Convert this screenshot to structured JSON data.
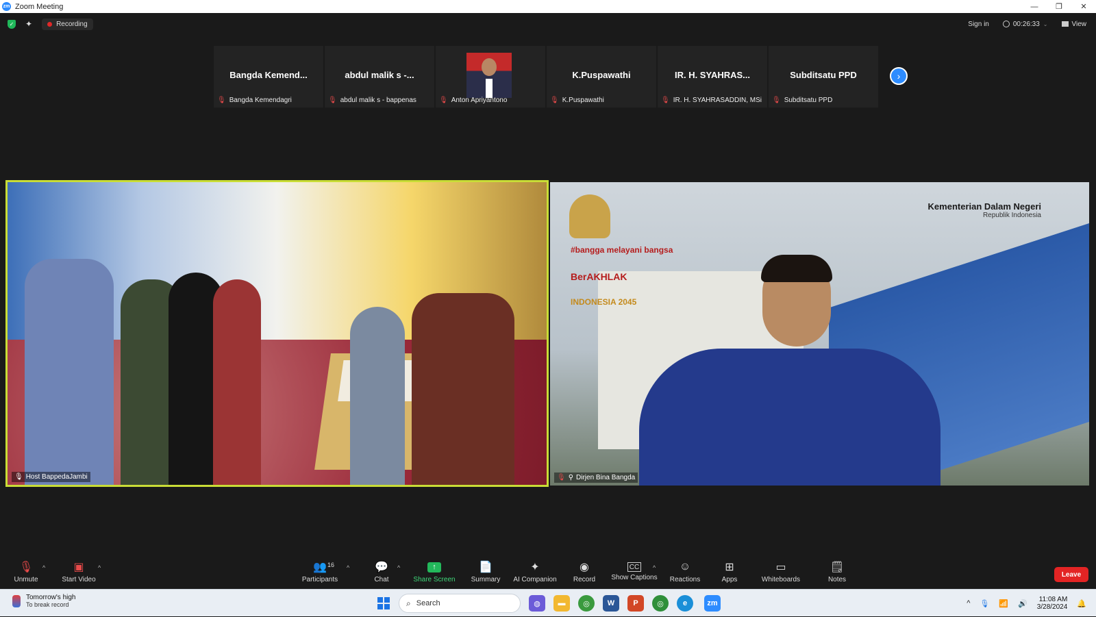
{
  "window": {
    "title": "Zoom Meeting",
    "controls": [
      "—",
      "❐",
      "✕"
    ]
  },
  "topbar": {
    "recording_label": "Recording",
    "sign_in": "Sign in",
    "timer": "00:26:33",
    "view_label": "View"
  },
  "gallery": {
    "tiles": [
      {
        "display": "Bangda Kemend...",
        "label": "Bangda Kemendagri"
      },
      {
        "display": "abdul malik s -...",
        "label": "abdul malik s - bappenas"
      },
      {
        "display": "",
        "label": "Anton Apriyantono"
      },
      {
        "display": "K.Puspawathi",
        "label": "K.Puspawathi"
      },
      {
        "display": "IR. H. SYAHRAS...",
        "label": "IR. H. SYAHRASADDIN, MSi"
      },
      {
        "display": "Subditsatu PPD",
        "label": "Subditsatu PPD"
      }
    ]
  },
  "videos": {
    "left": {
      "label": "Host BappedaJambi"
    },
    "right": {
      "label": "Dirjen Bina Bangda",
      "backdrop_title": "Kementerian Dalam Negeri",
      "backdrop_sub": "Republik Indonesia",
      "logo_1": "#bangga melayani bangsa",
      "logo_2": "BerAKHLAK",
      "logo_3": "INDONESIA 2045"
    }
  },
  "toolbar": {
    "unmute": "Unmute",
    "start_video": "Start Video",
    "participants": "Participants",
    "participants_count": "16",
    "chat": "Chat",
    "share_screen": "Share Screen",
    "summary": "Summary",
    "ai_companion": "AI Companion",
    "record": "Record",
    "show_captions": "Show Captions",
    "reactions": "Reactions",
    "apps": "Apps",
    "whiteboards": "Whiteboards",
    "notes": "Notes",
    "leave": "Leave"
  },
  "taskbar": {
    "weather_title": "Tomorrow's high",
    "weather_sub": "To break record",
    "search_label": "Search",
    "time": "11:08 AM",
    "date": "3/28/2024"
  },
  "colors": {
    "accent": "#2d8cff",
    "active_speaker": "#c9dd36",
    "leave": "#e32424",
    "share": "#23b85b",
    "recording": "#e02828"
  }
}
